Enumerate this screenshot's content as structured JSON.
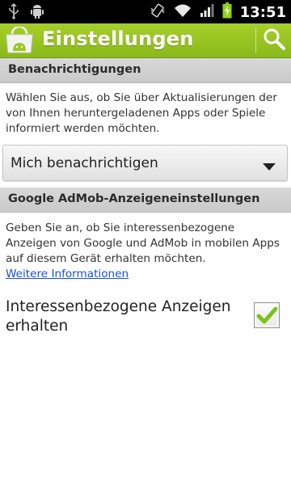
{
  "status_bar": {
    "time": "13:51",
    "icons": [
      "usb-icon",
      "android-debug-icon",
      "vibrate-icon",
      "wifi-icon",
      "signal-icon",
      "battery-charging-icon"
    ]
  },
  "action_bar": {
    "title": "Einstellungen",
    "app_icon": "market-bag-icon",
    "search_icon": "search-icon",
    "colors": {
      "bar": "#9bc822",
      "title": "#ffffff"
    }
  },
  "notifications": {
    "header": "Benachrichtigungen",
    "description": "Wählen Sie aus, ob Sie über Aktualisierungen der von Ihnen heruntergeladenen Apps oder Spiele informiert werden möchten.",
    "dropdown_value": "Mich benachrichtigen"
  },
  "admob": {
    "header": "Google AdMob-Anzeigeneinstellungen",
    "description": "Geben Sie an, ob Sie interessenbezogene Anzeigen von Google und AdMob in mobilen Apps auf diesem Gerät erhalten möchten.",
    "link": "Weitere Informationen",
    "checkbox_label": "Interessenbezogene Anzeigen erhalten",
    "checkbox_checked": true,
    "check_color": "#7cc21a"
  }
}
